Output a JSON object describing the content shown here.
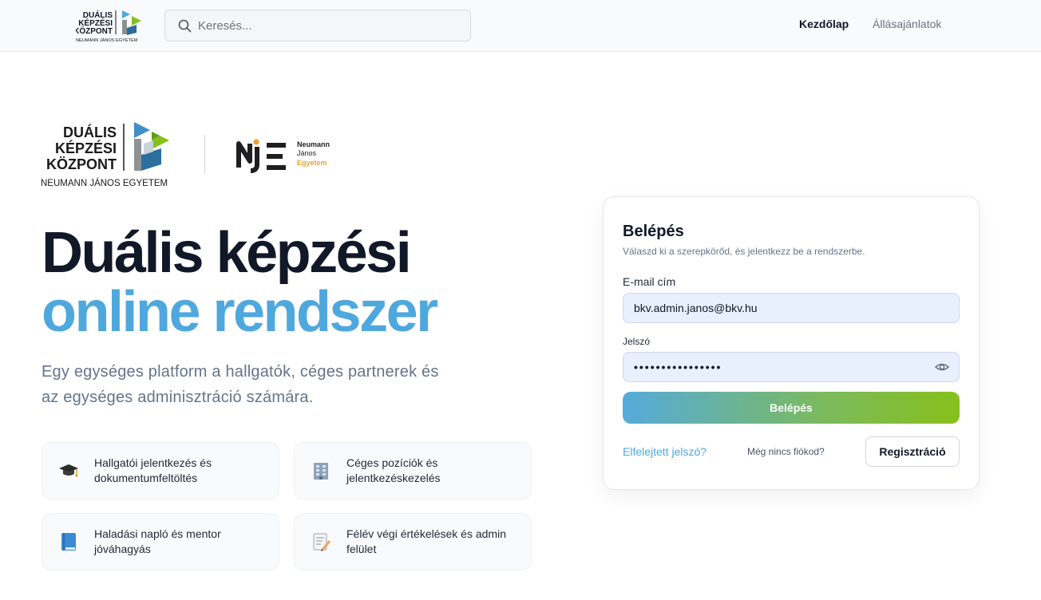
{
  "header": {
    "logo": {
      "line1": "DUÁLIS",
      "line2": "KÉPZÉSI",
      "line3": "KÖZPONT",
      "line4": "NEUMANN JÁNOS EGYETEM"
    },
    "search": {
      "placeholder": "Keresés...",
      "value": ""
    },
    "nav": {
      "home": "Kezdőlap",
      "jobs": "Állásajánlatok"
    }
  },
  "brand": {
    "dkk": {
      "line1": "DUÁLIS",
      "line2": "KÉPZÉSI",
      "line3": "KÖZPONT",
      "line4": "NEUMANN JÁNOS EGYETEM"
    },
    "nje": {
      "mark": "NJE",
      "line1": "Neumann",
      "line2": "János",
      "line3": "Egyetem"
    }
  },
  "hero": {
    "title_line1": "Duális képzési",
    "title_line2": "online rendszer",
    "subtitle": "Egy egységes platform a hallgatók, céges partnerek és az egységes adminisztráció számára."
  },
  "features": [
    {
      "icon": "graduation-cap-icon",
      "text": "Hallgatói jelentkezés és dokumentumfeltöltés"
    },
    {
      "icon": "office-building-icon",
      "text": "Céges pozíciók és jelentkezéskezelés"
    },
    {
      "icon": "book-icon",
      "text": "Haladási napló és mentor jóváhagyás"
    },
    {
      "icon": "memo-icon",
      "text": "Félév végi értékelések és admin felület"
    }
  ],
  "login": {
    "title": "Belépés",
    "subtitle": "Válaszd ki a szerepkörőd, és jelentkezz be a rendszerbe.",
    "email_label": "E-mail cím",
    "email_value": "bkv.admin.janos@bkv.hu",
    "password_label": "Jelszó",
    "password_value": "••••••••••••••••",
    "submit_label": "Belépés",
    "forgot_label": "Elfelejtett jelszó?",
    "no_account_label": "Még nincs fiókod?",
    "register_label": "Regisztráció"
  },
  "colors": {
    "accent_blue": "#4fa8dd",
    "accent_green": "#86c01b",
    "nje_orange": "#e8a13a",
    "title_dark": "#111827"
  }
}
